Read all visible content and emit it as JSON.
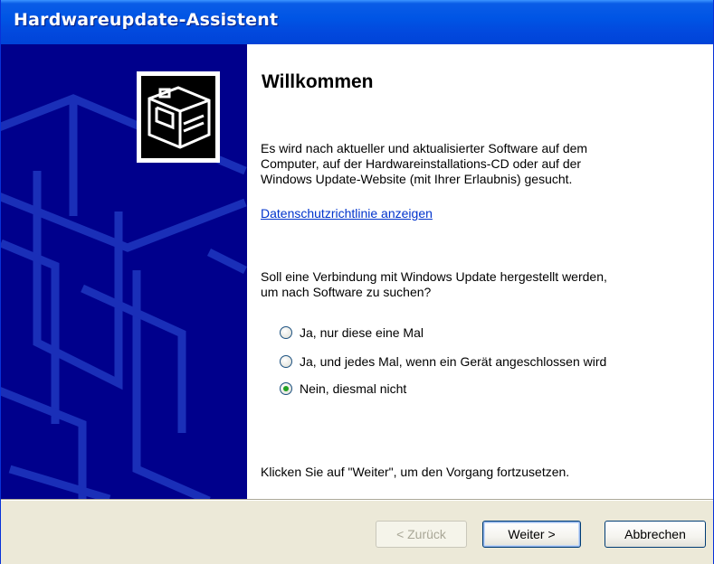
{
  "window": {
    "title": "Hardwareupdate-Assistent"
  },
  "content": {
    "heading": "Willkommen",
    "intro_lines": [
      "Es wird nach aktueller und aktualisierter Software auf dem",
      "Computer, auf der Hardwareinstallations-CD oder auf der",
      "Windows Update-Website (mit Ihrer Erlaubnis) gesucht."
    ],
    "privacy_link": "Datenschutzrichtlinie anzeigen",
    "question_lines": [
      "Soll eine Verbindung mit Windows Update hergestellt werden,",
      "um nach Software zu suchen?"
    ],
    "options": [
      {
        "label": "Ja, nur diese eine Mal",
        "checked": false
      },
      {
        "label": "Ja, und jedes Mal, wenn ein Gerät angeschlossen wird",
        "checked": false
      },
      {
        "label": "Nein, diesmal nicht",
        "checked": true
      }
    ],
    "footer": "Klicken Sie auf \"Weiter\", um den Vorgang fortzusetzen."
  },
  "buttons": {
    "back": "< Zurück",
    "next": "Weiter >",
    "cancel": "Abbrechen"
  },
  "side_panel": {
    "icon": "hardware-device-icon",
    "background_color": "#00008c"
  }
}
